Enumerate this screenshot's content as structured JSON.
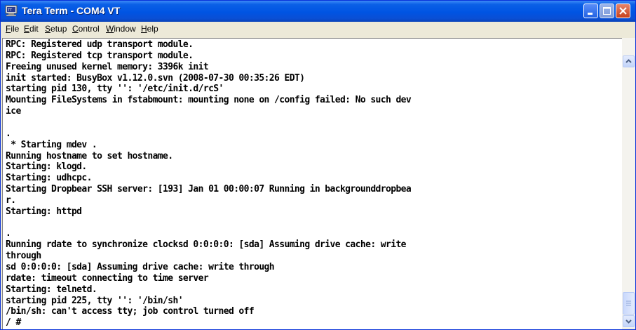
{
  "window": {
    "title": "Tera Term - COM4 VT",
    "icon": "teraterm-app-icon"
  },
  "titlebar_buttons": {
    "minimize": "minimize-icon",
    "maximize": "maximize-icon",
    "close": "close-icon"
  },
  "menu": {
    "items": [
      {
        "label": "File"
      },
      {
        "label": "Edit"
      },
      {
        "label": "Setup"
      },
      {
        "label": "Control"
      },
      {
        "label": "Window"
      },
      {
        "label": "Help"
      }
    ]
  },
  "terminal": {
    "lines": [
      "RPC: Registered udp transport module.",
      "RPC: Registered tcp transport module.",
      "Freeing unused kernel memory: 3396k init",
      "init started: BusyBox v1.12.0.svn (2008-07-30 00:35:26 EDT)",
      "starting pid 130, tty '': '/etc/init.d/rcS'",
      "Mounting FileSystems in fstabmount: mounting none on /config failed: No such dev",
      "ice",
      "",
      ".",
      " * Starting mdev .",
      "Running hostname to set hostname.",
      "Starting: klogd.",
      "Starting: udhcpc.",
      "Starting Dropbear SSH server: [193] Jan 01 00:00:07 Running in backgrounddropbea",
      "r.",
      "Starting: httpd",
      "",
      ".",
      "Running rdate to synchronize clocksd 0:0:0:0: [sda] Assuming drive cache: write",
      "through",
      "sd 0:0:0:0: [sda] Assuming drive cache: write through",
      "rdate: timeout connecting to time server",
      "Starting: telnetd.",
      "starting pid 225, tty '': '/bin/sh'",
      "/bin/sh: can't access tty; job control turned off",
      "/ #"
    ]
  },
  "scrollbar": {
    "up": "scroll-up-arrow-icon",
    "down": "scroll-down-arrow-icon",
    "thumb": "scroll-thumb",
    "position": "bottom"
  },
  "colors": {
    "titlebar": "#0054e3",
    "terminal_bg": "#ffffff",
    "terminal_fg": "#000000",
    "menubar": "#ece9d8"
  }
}
